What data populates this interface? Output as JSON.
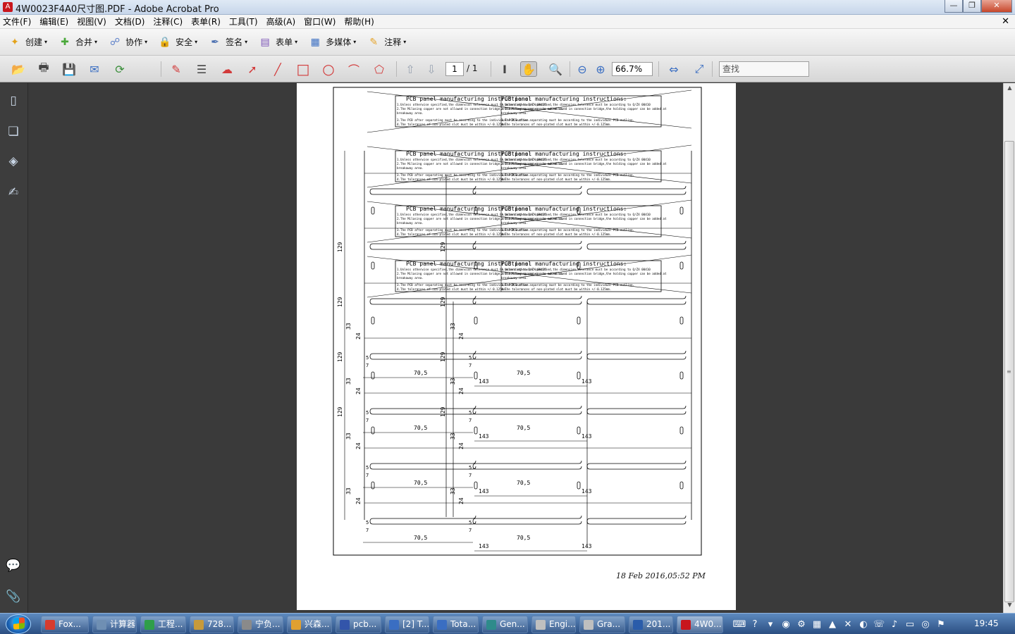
{
  "window": {
    "title": "4W0023F4A0尺寸图.PDF - Adobe Acrobat Pro",
    "app_icon_glyph": "A",
    "minimize_glyph": "—",
    "maximize_glyph": "❐",
    "close_glyph": "✕"
  },
  "menu": {
    "items": [
      "文件(F)",
      "编辑(E)",
      "视图(V)",
      "文档(D)",
      "注释(C)",
      "表单(R)",
      "工具(T)",
      "高级(A)",
      "窗口(W)",
      "帮助(H)"
    ],
    "doc_close_glyph": "✕"
  },
  "tasks": {
    "items": [
      {
        "label": "创建",
        "icon": "create-icon",
        "glyph": "✦",
        "color": "#e3a21a"
      },
      {
        "label": "合并",
        "icon": "combine-icon",
        "glyph": "✚",
        "color": "#4aa83a"
      },
      {
        "label": "协作",
        "icon": "collaborate-icon",
        "glyph": "☍",
        "color": "#5a7ec8"
      },
      {
        "label": "安全",
        "icon": "lock-icon",
        "glyph": "🔒",
        "color": "#d7a826"
      },
      {
        "label": "签名",
        "icon": "pen-icon",
        "glyph": "✒",
        "color": "#4b6fb0"
      },
      {
        "label": "表单",
        "icon": "form-icon",
        "glyph": "▤",
        "color": "#7b52b8"
      },
      {
        "label": "多媒体",
        "icon": "multimedia-icon",
        "glyph": "▦",
        "color": "#3a6ec2"
      },
      {
        "label": "注释",
        "icon": "comment-icon",
        "glyph": "✎",
        "color": "#e6a52c"
      }
    ],
    "caret_glyph": "▾"
  },
  "toolbar": {
    "page_current": "1",
    "page_total": "/ 1",
    "zoom": "66.7%",
    "zoom_caret": "▾",
    "find_placeholder": "查找",
    "find_caret": "▾",
    "colors": {
      "markup": "#d23a3a",
      "arrows_disabled": "#9aa4b2"
    }
  },
  "tool_glyphs": {
    "open": "📂",
    "print": "🖶",
    "save": "💾",
    "email": "✉",
    "upload": "⟳",
    "text_edit": "✎",
    "textbox": "☰",
    "cloud": "☁",
    "arrow": "➚",
    "line": "╱",
    "rectangle": "□",
    "ellipse": "○",
    "polygon_line": "⌒",
    "polygon": "⬠",
    "prev_page": "⇧",
    "next_page": "⇩",
    "select": "I",
    "hand": "✋",
    "zoom_marquee": "🔍",
    "zoom_out": "⊖",
    "zoom_in": "⊕",
    "fit_width": "⇔",
    "fit_page": "⤢"
  },
  "nav_glyphs": {
    "pages": "▯",
    "bookmarks": "❏",
    "layers": "◈",
    "signatures": "✍",
    "comments": "💬",
    "attachments": "📎"
  },
  "document": {
    "timestamp": "18 Feb 2016,05:52 PM",
    "instruction_title": "PCB panel manufacturing instructions:",
    "instruction_lines": [
      "1.Unless otherwise specified,the dimension tolerance must be according to Q/ZX 00410",
      "2.The Milasing copper are not allowed in connection bridge,the holding copper can be added at",
      "  breakaway area.",
      "3.The PCB after separating must be according to the individual PCB outline.",
      "4.The tolerances of non-plated slot must be within +/-0.125mm."
    ],
    "dim_129": "129",
    "dim_33": "33",
    "dim_24": "24",
    "dim_5": "5",
    "dim_7": "7",
    "dim_705": "70,5",
    "dim_143": "143"
  },
  "scrollbar": {
    "up": "▲",
    "down": "▼",
    "grip": "≡"
  },
  "taskbar": {
    "items": [
      {
        "label": "Fox...",
        "color": "#d63b2f"
      },
      {
        "label": "计算器",
        "color": "#6f8fb3"
      },
      {
        "label": "工程...",
        "color": "#2f9e4a"
      },
      {
        "label": "728...",
        "color": "#c79a3a"
      },
      {
        "label": "宁负...",
        "color": "#8a8a8a"
      },
      {
        "label": "兴森...",
        "color": "#e0a030"
      },
      {
        "label": "pcb...",
        "color": "#3355aa"
      },
      {
        "label": "[2] T...",
        "color": "#3a6ec2"
      },
      {
        "label": "Tota...",
        "color": "#3a6ec2"
      },
      {
        "label": "Gen...",
        "color": "#2e8b8b"
      },
      {
        "label": "Engi...",
        "color": "#bfbfbf"
      },
      {
        "label": "Gra...",
        "color": "#bfbfbf"
      },
      {
        "label": "201...",
        "color": "#2a5caa"
      },
      {
        "label": "4W0...",
        "color": "#c8161d"
      }
    ],
    "tray_glyphs": [
      "⌨",
      "?",
      "▾",
      "◉",
      "⚙",
      "▦",
      "▲",
      "✕",
      "◐",
      "☏",
      "♪",
      "▭",
      "◎",
      "⚑"
    ],
    "clock": "19:45"
  }
}
